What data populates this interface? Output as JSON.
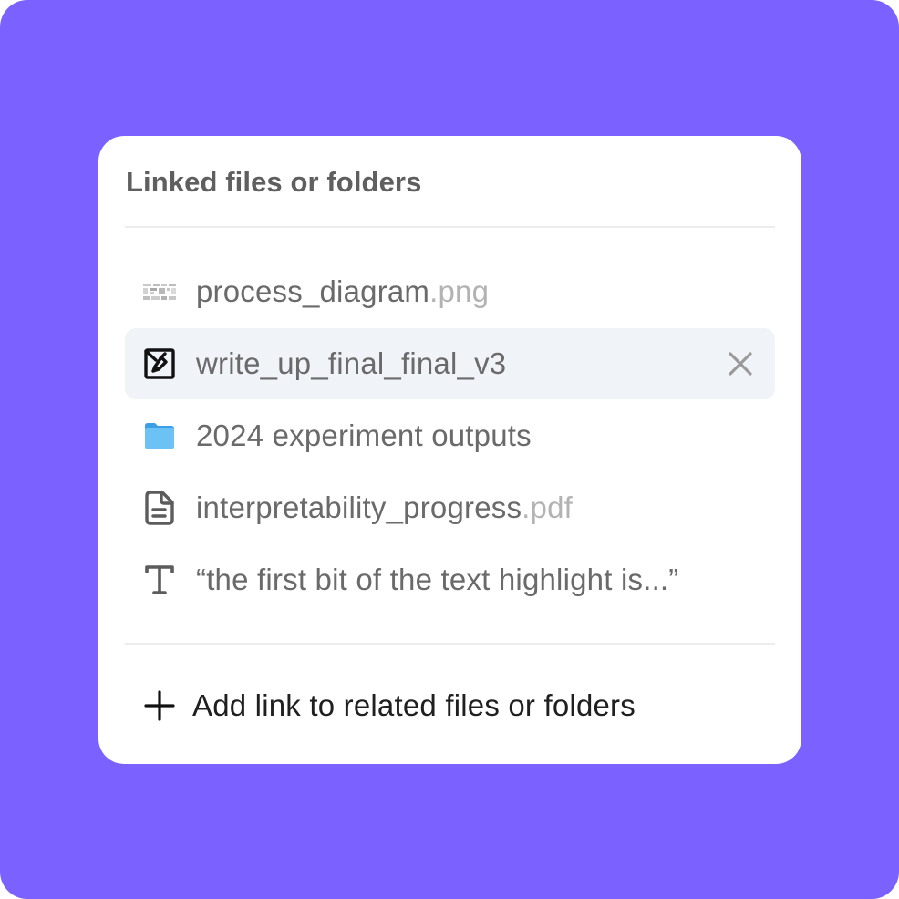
{
  "panel": {
    "title": "Linked files or folders"
  },
  "files": [
    {
      "icon": "image-thumbnail-icon",
      "name": "process_diagram",
      "ext": ".png"
    },
    {
      "icon": "linked-doc-icon",
      "name": "write_up_final_final_v3",
      "ext": "",
      "active": true,
      "remove_icon": "close-icon"
    },
    {
      "icon": "folder-icon",
      "name": "2024 experiment outputs",
      "ext": ""
    },
    {
      "icon": "document-icon",
      "name": "interpretability_progress",
      "ext": ".pdf"
    },
    {
      "icon": "text-icon",
      "name": "“the first bit of the text highlight is...”",
      "ext": ""
    }
  ],
  "add_link": {
    "icon": "plus-icon",
    "label": "Add link to related files or folders"
  },
  "colors": {
    "background": "#7b61ff",
    "card": "#ffffff",
    "active_row": "#f0f3f7",
    "folder": "#6cc1f5",
    "extension_text": "#b3b3b3"
  }
}
